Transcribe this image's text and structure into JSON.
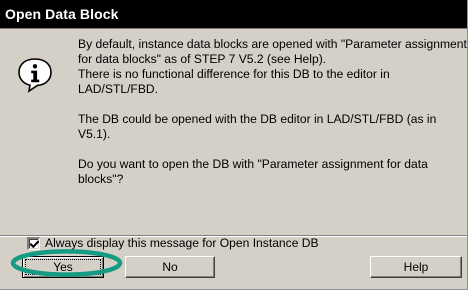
{
  "window": {
    "title": "Open Data Block"
  },
  "message": {
    "paragraph1": [
      "By default, instance data blocks are opened with \"Parameter assignment",
      "for data blocks\" as of STEP 7 V5.2 (see Help).",
      "There is no functional difference for this DB to the editor in",
      "LAD/STL/FBD."
    ],
    "paragraph2": [
      "The DB could be opened with the DB editor in LAD/STL/FBD (as in",
      "V5.1)."
    ],
    "paragraph3": [
      "Do you want to open the DB with \"Parameter assignment for data",
      "blocks\"?"
    ]
  },
  "checkbox": {
    "label": "Always display this message for Open Instance DB",
    "checked": true
  },
  "buttons": {
    "yes": "Yes",
    "no": "No",
    "help": "Help"
  },
  "icons": {
    "message_icon": "info-icon",
    "check_icon": "check-icon"
  },
  "colors": {
    "titlebar": "#000000",
    "dialog_face": "#d4d0c8",
    "highlight_oval": "#169b83"
  }
}
